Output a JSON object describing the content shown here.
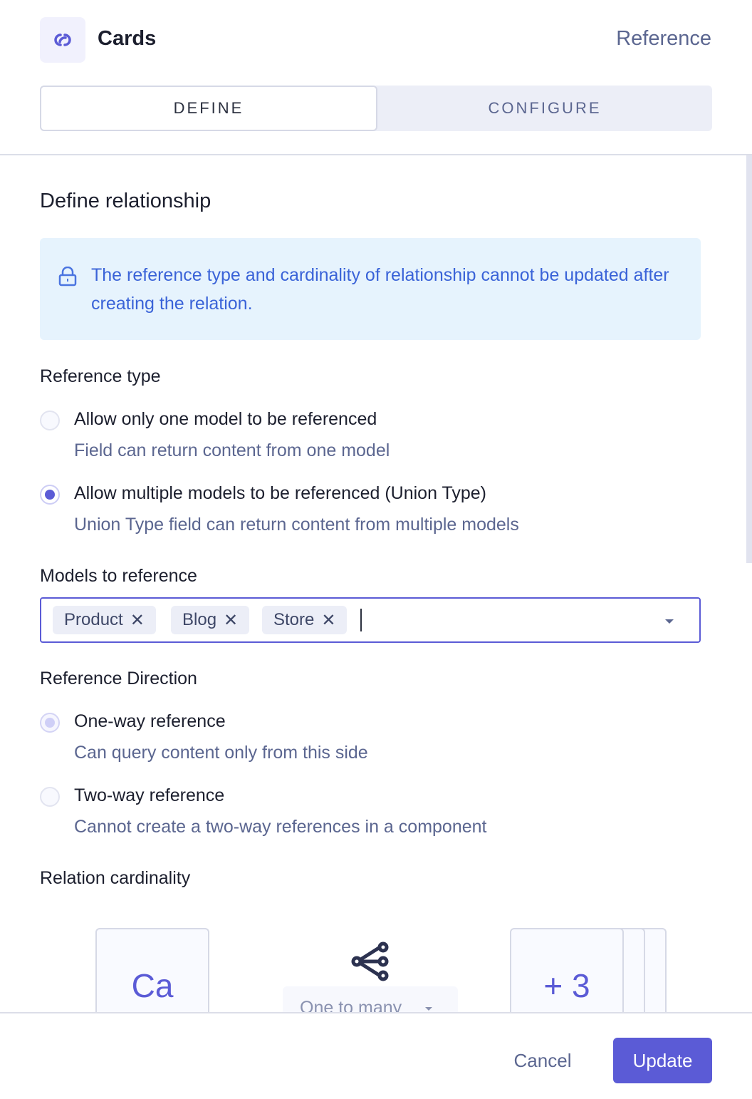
{
  "header": {
    "title": "Cards",
    "field_type": "Reference",
    "icon": "link-icon"
  },
  "tabs": [
    {
      "label": "DEFINE",
      "active": true
    },
    {
      "label": "CONFIGURE",
      "active": false
    }
  ],
  "section": {
    "title": "Define relationship"
  },
  "notice": {
    "icon": "lock-icon",
    "text": "The reference type and cardinality of relationship cannot be updated after creating the relation."
  },
  "reference_type": {
    "label": "Reference type",
    "options": [
      {
        "label": "Allow only one model to be referenced",
        "description": "Field can return content from one model",
        "selected": false
      },
      {
        "label": "Allow multiple models to be referenced (Union Type)",
        "description": "Union Type field can return content from multiple models",
        "selected": true
      }
    ]
  },
  "models": {
    "label": "Models to reference",
    "selected": [
      "Product",
      "Blog",
      "Store"
    ],
    "remove_glyph": "✕"
  },
  "reference_direction": {
    "label": "Reference Direction",
    "options": [
      {
        "label": "One-way reference",
        "description": "Can query content only from this side",
        "selected": true,
        "disabled": true
      },
      {
        "label": "Two-way reference",
        "description": "Cannot create a two-way references in a component",
        "selected": false,
        "disabled": true
      }
    ]
  },
  "cardinality": {
    "label": "Relation cardinality",
    "source_card": "Ca",
    "icon": "one-to-many-icon",
    "selected": "One to many",
    "target_card": "+ 3"
  },
  "footer": {
    "cancel_label": "Cancel",
    "update_label": "Update"
  },
  "colors": {
    "accent": "#5b5bd6",
    "notice_bg": "#e6f3fd",
    "notice_text": "#3a63d8",
    "muted_text": "#5b6690"
  }
}
